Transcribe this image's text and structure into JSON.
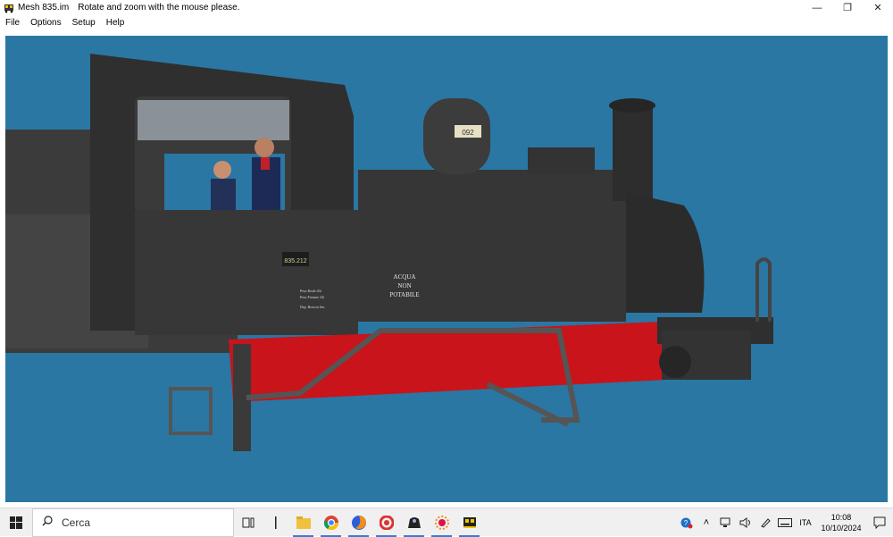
{
  "window": {
    "title": "Mesh 835.im",
    "message": "Rotate and zoom with the mouse please.",
    "controls": {
      "minimize": "—",
      "restore": "❐",
      "close": "✕"
    }
  },
  "menu": {
    "items": [
      "File",
      "Options",
      "Setup",
      "Help"
    ]
  },
  "viewport": {
    "background": "#2a77a3",
    "locomotive": {
      "number_plate": "835.212",
      "dome_plate": "092",
      "tank_lettering": [
        "ACQUA",
        "NON",
        "POTABILE"
      ],
      "cab_lettering": [
        "Peso Reale 43t",
        "Peso Frenato 34t",
        "Dep. Brescia Ses."
      ]
    }
  },
  "taskbar": {
    "search_placeholder": "Cerca",
    "apps": [
      "task-view",
      "divider",
      "file-explorer",
      "chrome",
      "firefox",
      "app-ccleaner",
      "app-train-dark",
      "app-sun",
      "app-train-yellow"
    ],
    "tray": {
      "language": "ITA",
      "time": "10:08",
      "date": "10/10/2024"
    }
  },
  "colors": {
    "accent": "#3a7bd5",
    "frame_red": "#c8141a",
    "body_dark": "#3a3a3a"
  }
}
